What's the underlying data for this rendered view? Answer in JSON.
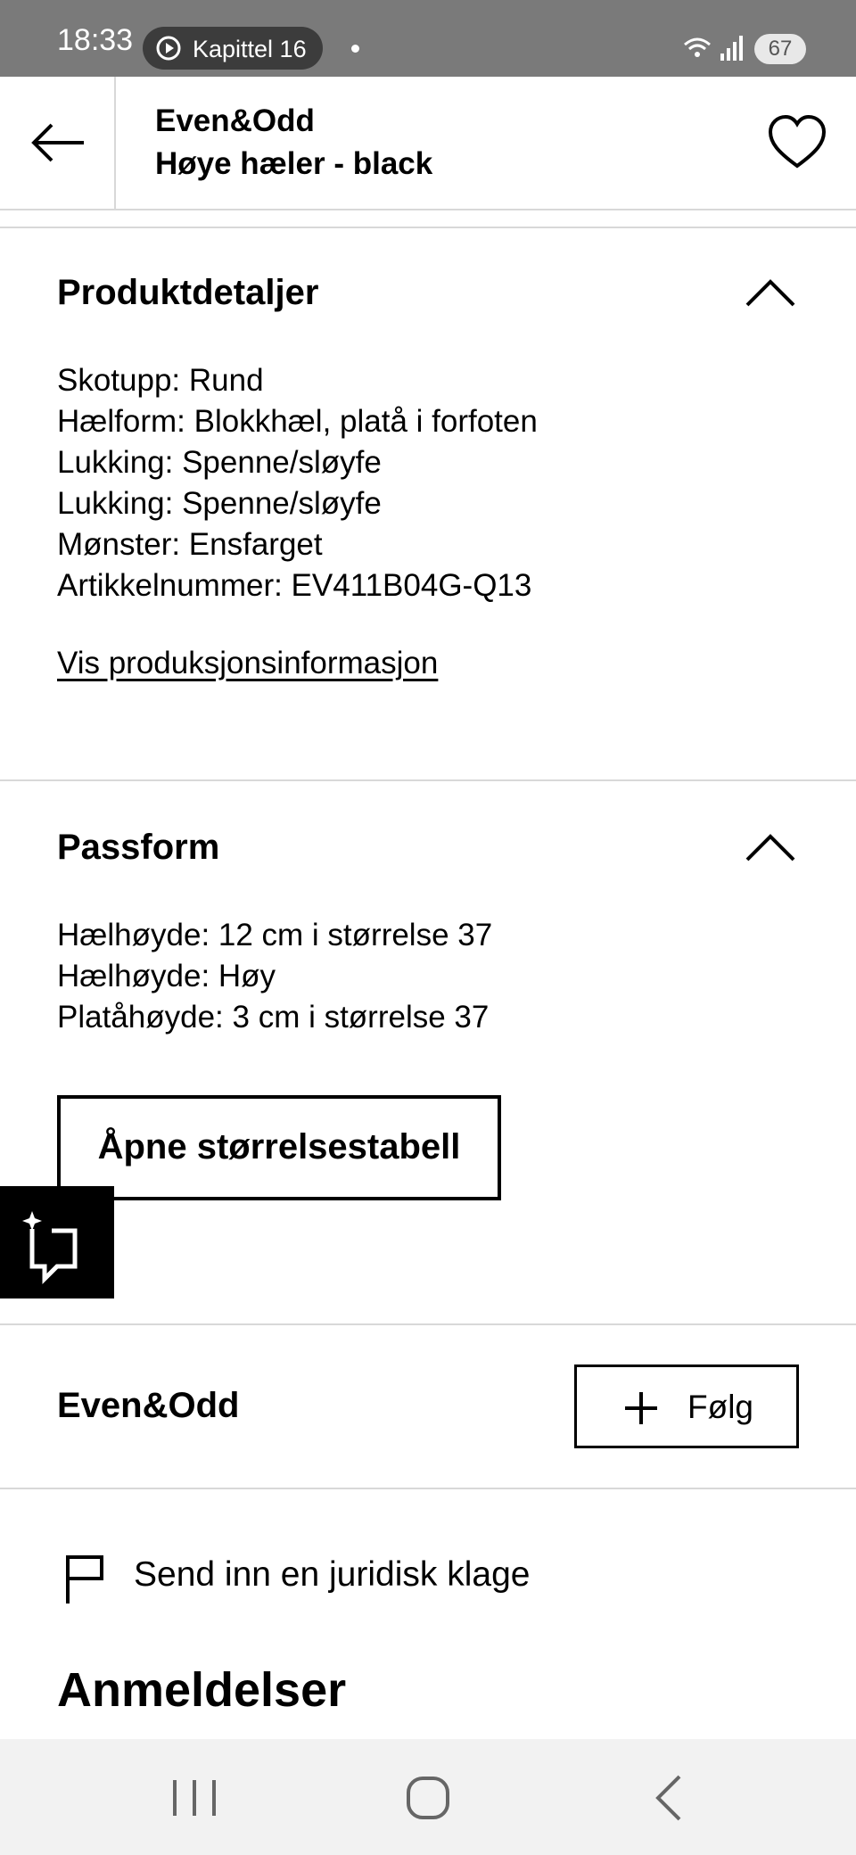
{
  "status_bar": {
    "time": "18:33",
    "media_label": "Kapittel 16",
    "battery": "67"
  },
  "header": {
    "brand": "Even&Odd",
    "product": "Høye hæler - black"
  },
  "product_details": {
    "title": "Produktdetaljer",
    "lines": [
      "Skotupp: Rund",
      "Hælform: Blokkhæl, platå i forfoten",
      "Lukking: Spenne/sløyfe",
      "Lukking: Spenne/sløyfe",
      "Mønster: Ensfarget",
      "Artikkelnummer: EV411B04G-Q13"
    ],
    "link": "Vis produksjonsinformasjon"
  },
  "fit": {
    "title": "Passform",
    "lines": [
      "Hælhøyde: 12 cm i størrelse 37",
      "Hælhøyde: Høy",
      "Platåhøyde: 3 cm i størrelse 37"
    ],
    "size_table_button": "Åpne størrelsestabell"
  },
  "brand_row": {
    "name": "Even&Odd",
    "follow_label": "Følg"
  },
  "complaint_label": "Send inn en juridisk klage",
  "reviews_title": "Anmeldelser",
  "colors": {
    "status_bar": "#7a7a7a",
    "nav_bar": "#f2f2f2",
    "divider": "#d8d8d8",
    "text": "#000000"
  },
  "icons": [
    "play-icon",
    "wifi-icon",
    "signal-icon",
    "back-arrow-icon",
    "heart-icon",
    "chevron-up-icon",
    "feedback-icon",
    "plus-icon",
    "flag-icon",
    "recent-apps-icon",
    "home-icon",
    "nav-back-icon"
  ]
}
